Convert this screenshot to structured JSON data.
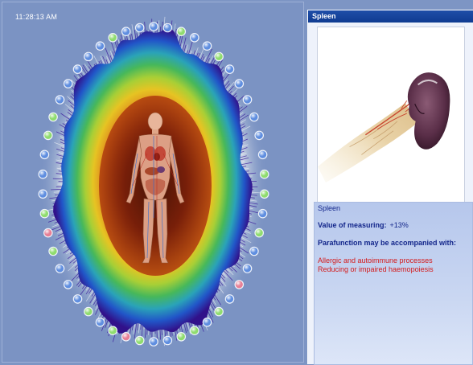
{
  "clock": {
    "time": "11:28:13 AM"
  },
  "panel": {
    "title": "Spleen",
    "organ_name": "Spleen",
    "measure_label": "Value of measuring:",
    "measure_value": "+13%",
    "parafunction_label": "Parafunction may be accompanied with:",
    "conditions": [
      "Allergic and autoimmune processes",
      "Reducing or impaired haemopoiesis"
    ]
  },
  "aura": {
    "center_color": "#3a0d05",
    "rings": [
      "#31118a",
      "#2155c8",
      "#2aa3b8",
      "#47b85a",
      "#a8cf36",
      "#e6c423",
      "#e08a1e",
      "#c24a14",
      "#7a1e0a"
    ]
  },
  "marker_colors": {
    "normal": "#5f8ee0",
    "good": "#8fdc6e",
    "alert": "#e77f96",
    "neutral": "#d9dde6"
  },
  "markers": [
    "normal",
    "normal",
    "good",
    "normal",
    "normal",
    "good",
    "normal",
    "normal",
    "normal",
    "normal",
    "normal",
    "normal",
    "good",
    "good",
    "normal",
    "good",
    "normal",
    "normal",
    "alert",
    "normal",
    "good",
    "normal",
    "good",
    "good",
    "normal",
    "normal",
    "good",
    "alert",
    "good",
    "normal",
    "good",
    "normal",
    "normal",
    "normal",
    "good",
    "alert",
    "good",
    "normal",
    "normal",
    "normal",
    "good",
    "good",
    "normal",
    "normal",
    "normal",
    "normal",
    "normal",
    "good",
    "normal",
    "normal"
  ]
}
